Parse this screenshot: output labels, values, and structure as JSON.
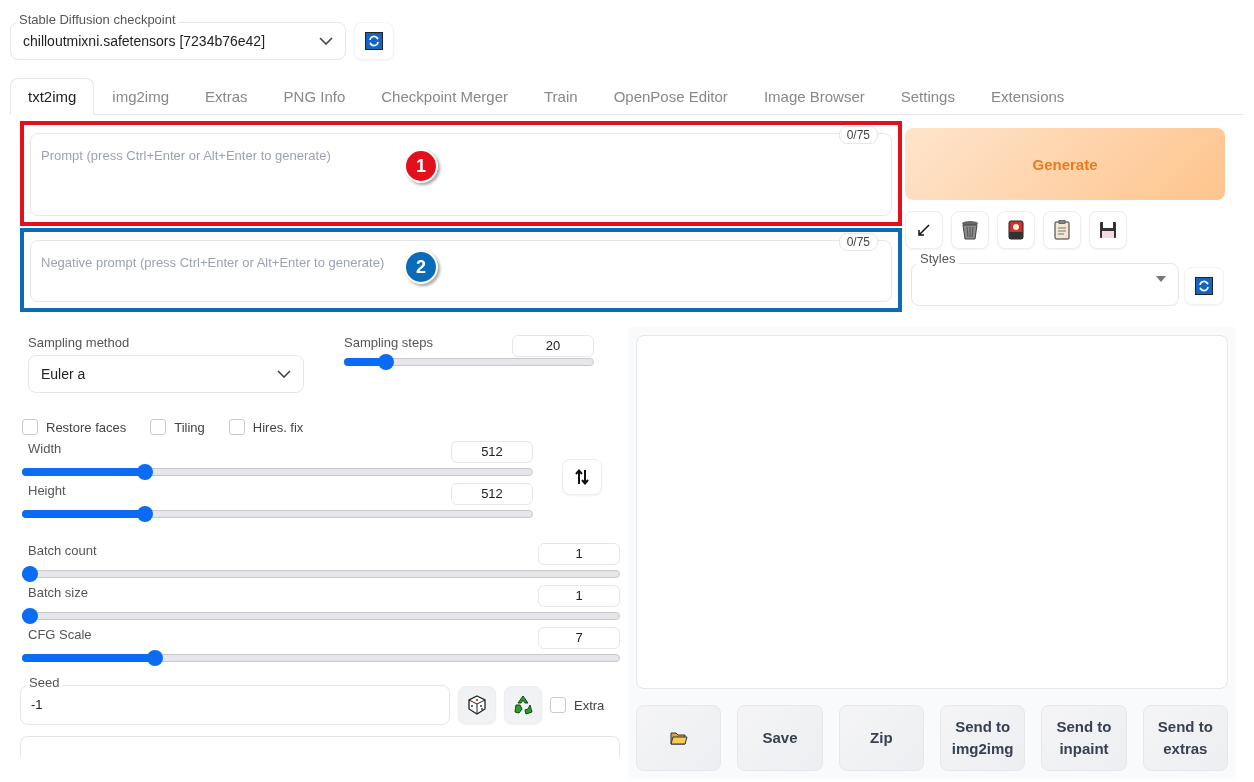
{
  "checkpoint": {
    "label": "Stable Diffusion checkpoint",
    "value": "chilloutmixni.safetensors [7234b76e42]"
  },
  "tabs": [
    {
      "label": "txt2img",
      "selected": true
    },
    {
      "label": "img2img",
      "selected": false
    },
    {
      "label": "Extras",
      "selected": false
    },
    {
      "label": "PNG Info",
      "selected": false
    },
    {
      "label": "Checkpoint Merger",
      "selected": false
    },
    {
      "label": "Train",
      "selected": false
    },
    {
      "label": "OpenPose Editor",
      "selected": false
    },
    {
      "label": "Image Browser",
      "selected": false
    },
    {
      "label": "Settings",
      "selected": false
    },
    {
      "label": "Extensions",
      "selected": false
    }
  ],
  "prompts": [
    {
      "placeholder": "Prompt (press Ctrl+Enter or Alt+Enter to generate)",
      "counter": "0/75",
      "annotation": {
        "number": "1",
        "color": "#e3101c"
      }
    },
    {
      "placeholder": "Negative prompt (press Ctrl+Enter or Alt+Enter to generate)",
      "counter": "0/75",
      "annotation": {
        "number": "2",
        "color": "#0a6cb8"
      }
    }
  ],
  "generate": {
    "label": "Generate"
  },
  "styles": {
    "label": "Styles"
  },
  "sampling_method": {
    "label": "Sampling method",
    "value": "Euler a"
  },
  "sampling_steps": {
    "label": "Sampling steps",
    "value": "20",
    "level": 0.145
  },
  "checkboxes": [
    {
      "label": "Restore faces",
      "checked": false
    },
    {
      "label": "Tiling",
      "checked": false
    },
    {
      "label": "Hires. fix",
      "checked": false
    }
  ],
  "size_sliders": [
    {
      "label": "Width",
      "value": "512",
      "level": 0.233
    },
    {
      "label": "Height",
      "value": "512",
      "level": 0.233
    }
  ],
  "batch_sliders": [
    {
      "label": "Batch count",
      "value": "1",
      "level": 0
    },
    {
      "label": "Batch size",
      "value": "1",
      "level": 0
    },
    {
      "label": "CFG Scale",
      "value": "7",
      "level": 0.214
    }
  ],
  "seed": {
    "label": "Seed",
    "value": "-1",
    "extra": {
      "label": "Extra",
      "checked": false
    }
  },
  "output_buttons": [
    "Save",
    "Zip",
    "Send to img2img",
    "Send to inpaint",
    "Send to extras"
  ]
}
